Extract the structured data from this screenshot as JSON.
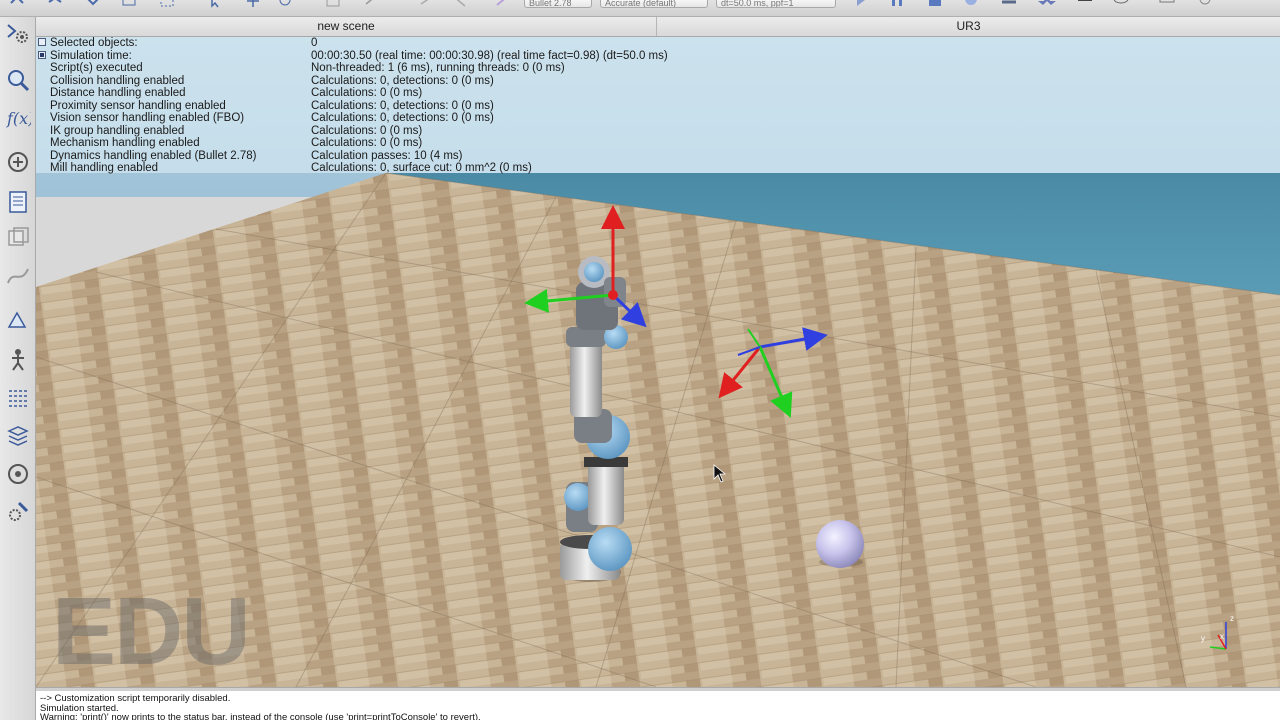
{
  "toolbar": {
    "combos": [
      "Bullet 2.78",
      "Accurate (default)",
      "dt=50.0 ms, ppf=1"
    ]
  },
  "tabs": [
    {
      "label": "new scene"
    },
    {
      "label": "UR3"
    }
  ],
  "info": [
    {
      "label": "Selected objects:",
      "value": "0"
    },
    {
      "label": "Simulation time:",
      "value": "00:00:30.50 (real time: 00:00:30.98) (real time fact=0.98) (dt=50.0 ms)"
    },
    {
      "label": "Script(s) executed",
      "value": "Non-threaded: 1 (6 ms), running threads: 0 (0 ms)"
    },
    {
      "label": "Collision handling enabled",
      "value": "Calculations: 0, detections: 0 (0 ms)"
    },
    {
      "label": "Distance handling enabled",
      "value": "Calculations: 0 (0 ms)"
    },
    {
      "label": "Proximity sensor handling enabled",
      "value": "Calculations: 0, detections: 0 (0 ms)"
    },
    {
      "label": "Vision sensor handling enabled (FBO)",
      "value": "Calculations: 0, detections: 0 (0 ms)"
    },
    {
      "label": "IK group handling enabled",
      "value": "Calculations: 0 (0 ms)"
    },
    {
      "label": "Mechanism handling enabled",
      "value": "Calculations: 0 (0 ms)"
    },
    {
      "label": "Dynamics handling enabled (Bullet 2.78)",
      "value": "Calculation passes: 10 (4 ms)"
    },
    {
      "label": "Mill handling enabled",
      "value": "Calculations: 0, surface cut: 0 mm^2 (0 ms)"
    }
  ],
  "watermark": "EDU",
  "axes_labels": {
    "x": "x",
    "y": "y",
    "z": "z"
  },
  "console": [
    "--> Customization script temporarily disabled.",
    "Simulation started.",
    "Warning: 'print()' now prints to the status bar, instead of the console (use 'print=printToConsole' to revert)."
  ],
  "colors": {
    "sky_top": "#a9c8dc",
    "sea": "#4f8fa8",
    "floor_light": "#d3c0a4",
    "floor_dark": "#a98e6e",
    "robot_blue": "#7ab3d9",
    "sphere": "#c8c4ec"
  },
  "left_tools": [
    "camera-pan-icon",
    "zoom-icon",
    "fit-view-icon",
    "object-shift-icon",
    "scene-hierarchy-icon",
    "page-icon",
    "path-icon",
    "model-browser-icon",
    "robot-icon",
    "layers-icon",
    "assemble-icon",
    "settings-icon"
  ]
}
